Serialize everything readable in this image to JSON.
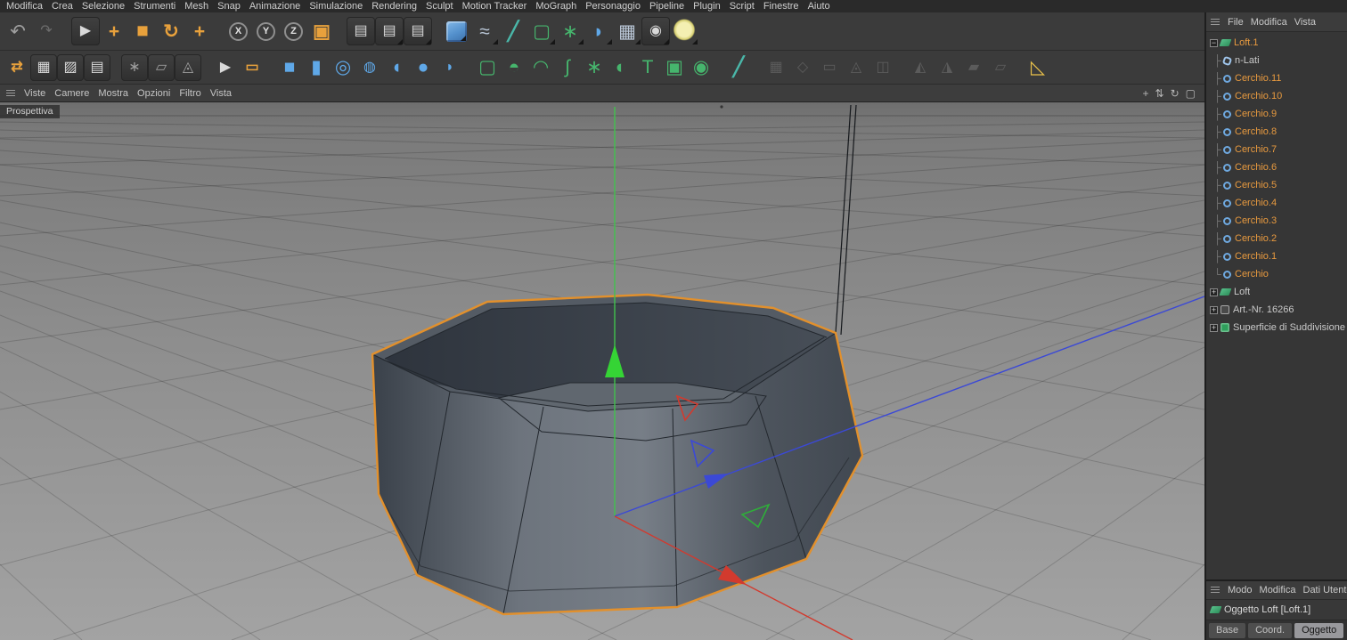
{
  "menubar": {
    "items": [
      "Modifica",
      "Crea",
      "Selezione",
      "Strumenti",
      "Mesh",
      "Snap",
      "Animazione",
      "Simulazione",
      "Rendering",
      "Sculpt",
      "Motion Tracker",
      "MoGraph",
      "Personaggio",
      "Pipeline",
      "Plugin",
      "Script",
      "Finestre",
      "Aiuto"
    ]
  },
  "toolbar": {
    "row1": [
      {
        "name": "undo",
        "glyph": "↶",
        "style": "gray xl"
      },
      {
        "name": "redo",
        "glyph": "↷",
        "style": "dim"
      },
      {
        "sep": true
      },
      {
        "name": "live-selection-tool",
        "glyph": "▶",
        "style": "btn light"
      },
      {
        "name": "move-tool",
        "glyph": "+",
        "style": "orange xl"
      },
      {
        "name": "scale-tool",
        "glyph": "◼",
        "style": "orange"
      },
      {
        "name": "rotate-tool",
        "glyph": "↻",
        "style": "orange xl"
      },
      {
        "name": "active-tool-move",
        "glyph": "+",
        "style": "orange xl"
      },
      {
        "sep": true
      },
      {
        "name": "x-axis-lock",
        "glyph": "X",
        "style": "ring"
      },
      {
        "name": "y-axis-lock",
        "glyph": "Y",
        "style": "ring"
      },
      {
        "name": "z-axis-lock",
        "glyph": "Z",
        "style": "ring"
      },
      {
        "name": "coordinate-system",
        "glyph": "▣",
        "style": "orange xl"
      },
      {
        "sep": true
      },
      {
        "name": "render-view",
        "glyph": "▤",
        "style": "btn light"
      },
      {
        "name": "render-picture-viewer",
        "glyph": "▤",
        "style": "btn light",
        "corner": true
      },
      {
        "name": "render-settings",
        "glyph": "▤",
        "style": "btn light",
        "corner": true
      },
      {
        "sep": true
      },
      {
        "name": "add-cube-primitive",
        "glyph": "",
        "style": "cube",
        "corner": true
      },
      {
        "name": "add-spline-pen",
        "glyph": "≈",
        "style": "bluegray xl",
        "corner": true
      },
      {
        "name": "sketch-pen",
        "glyph": "╱",
        "style": "teal xl"
      },
      {
        "name": "add-subdivision-surface",
        "glyph": "▢",
        "style": "green xl",
        "corner": true
      },
      {
        "name": "add-array-generator",
        "glyph": "∗",
        "style": "green xl",
        "corner": true
      },
      {
        "name": "add-deformer",
        "glyph": "◗",
        "style": "blue xl",
        "corner": true
      },
      {
        "name": "add-floor-object",
        "glyph": "▦",
        "style": "bluegray xl",
        "corner": true
      },
      {
        "name": "add-camera-object",
        "glyph": "◉",
        "style": "btn light",
        "corner": true
      },
      {
        "name": "add-light-object",
        "glyph": "",
        "style": "bulb",
        "corner": true
      }
    ],
    "row2": [
      {
        "name": "make-editable",
        "glyph": "⇄",
        "style": "orange"
      },
      {
        "name": "model-mode",
        "glyph": "▦",
        "style": "btn light"
      },
      {
        "name": "texture-mode",
        "glyph": "▨",
        "style": "btn light"
      },
      {
        "name": "workplane-mode",
        "glyph": "▤",
        "style": "btn light"
      },
      {
        "sep": true
      },
      {
        "name": "points-mode",
        "glyph": "∗",
        "style": "btn gray"
      },
      {
        "name": "edges-mode",
        "glyph": "▱",
        "style": "btn gray"
      },
      {
        "name": "polygons-mode",
        "glyph": "◬",
        "style": "btn gray"
      },
      {
        "sep": true
      },
      {
        "name": "live-selection-2",
        "glyph": "▶",
        "style": "light"
      },
      {
        "name": "rectangle-selection",
        "glyph": "▭",
        "style": "orange"
      },
      {
        "sep": true
      },
      {
        "name": "cube-primitive",
        "glyph": "■",
        "style": "blue xl"
      },
      {
        "name": "cylinder-primitive",
        "glyph": "▮",
        "style": "blue xl"
      },
      {
        "name": "tube-primitive",
        "glyph": "◎",
        "style": "blue xl"
      },
      {
        "name": "disc-primitive",
        "glyph": "◍",
        "style": "blue"
      },
      {
        "name": "torus-primitive",
        "glyph": "◖",
        "style": "blue xl"
      },
      {
        "name": "sphere-primitive",
        "glyph": "●",
        "style": "blue xl"
      },
      {
        "name": "oil-tank-primitive",
        "glyph": "◗",
        "style": "blue"
      },
      {
        "sep": true
      },
      {
        "name": "loft-generator",
        "glyph": "▢",
        "style": "green xl"
      },
      {
        "name": "lathe-generator",
        "glyph": "◓",
        "style": "green xl"
      },
      {
        "name": "sweep-generator",
        "glyph": "◠",
        "style": "green xl"
      },
      {
        "name": "bezier-generator",
        "glyph": "∫",
        "style": "green xl"
      },
      {
        "name": "atom-array",
        "glyph": "∗",
        "style": "green xl"
      },
      {
        "name": "boole-object",
        "glyph": "◐",
        "style": "green xl"
      },
      {
        "name": "text-object",
        "glyph": "T",
        "style": "green xl"
      },
      {
        "name": "instance-object",
        "glyph": "▣",
        "style": "green xl"
      },
      {
        "name": "metaball-object",
        "glyph": "◉",
        "style": "green xl"
      },
      {
        "sep": true
      },
      {
        "name": "spline-pen-2",
        "glyph": "╱",
        "style": "teal xl"
      },
      {
        "sep": true
      },
      {
        "name": "mesh-tool-1",
        "glyph": "▦",
        "style": "gray disabled"
      },
      {
        "name": "mesh-tool-2",
        "glyph": "◇",
        "style": "gray disabled"
      },
      {
        "name": "mesh-tool-3",
        "glyph": "▭",
        "style": "gray disabled"
      },
      {
        "name": "mesh-tool-4",
        "glyph": "◬",
        "style": "gray disabled"
      },
      {
        "name": "mesh-tool-5",
        "glyph": "◫",
        "style": "gray disabled"
      },
      {
        "sep": true
      },
      {
        "name": "snap-tool-1",
        "glyph": "◭",
        "style": "gray disabled"
      },
      {
        "name": "snap-tool-2",
        "glyph": "◮",
        "style": "gray disabled"
      },
      {
        "name": "snap-tool-3",
        "glyph": "▰",
        "style": "gray disabled"
      },
      {
        "name": "snap-tool-4",
        "glyph": "▱",
        "style": "gray disabled"
      },
      {
        "sep": true
      },
      {
        "name": "measure-tool",
        "glyph": "◺",
        "style": "yellow xl"
      }
    ]
  },
  "viewport": {
    "label": "Prospettiva",
    "menu": [
      "Viste",
      "Camere",
      "Mostra",
      "Opzioni",
      "Filtro",
      "Vista"
    ],
    "nav_icons": [
      {
        "name": "pan-view-icon",
        "glyph": "+"
      },
      {
        "name": "zoom-view-icon",
        "glyph": "⇅"
      },
      {
        "name": "orbit-view-icon",
        "glyph": "↻"
      },
      {
        "name": "toggle-layout-icon",
        "glyph": "▢"
      }
    ]
  },
  "object_manager": {
    "menu": [
      "File",
      "Modifica",
      "Vista"
    ],
    "rows": [
      {
        "label": "Loft.1",
        "color": "orange",
        "icon": "loft",
        "expand": "−",
        "tick": ""
      },
      {
        "label": "n-Lati",
        "color": "gray",
        "icon": "ngon",
        "tick": "├"
      },
      {
        "label": "Cerchio.11",
        "color": "orange",
        "icon": "circle",
        "tick": "├"
      },
      {
        "label": "Cerchio.10",
        "color": "orange",
        "icon": "circle",
        "tick": "├"
      },
      {
        "label": "Cerchio.9",
        "color": "orange",
        "icon": "circle",
        "tick": "├"
      },
      {
        "label": "Cerchio.8",
        "color": "orange",
        "icon": "circle",
        "tick": "├"
      },
      {
        "label": "Cerchio.7",
        "color": "orange",
        "icon": "circle",
        "tick": "├"
      },
      {
        "label": "Cerchio.6",
        "color": "orange",
        "icon": "circle",
        "tick": "├"
      },
      {
        "label": "Cerchio.5",
        "color": "orange",
        "icon": "circle",
        "tick": "├"
      },
      {
        "label": "Cerchio.4",
        "color": "orange",
        "icon": "circle",
        "tick": "├"
      },
      {
        "label": "Cerchio.3",
        "color": "orange",
        "icon": "circle",
        "tick": "├"
      },
      {
        "label": "Cerchio.2",
        "color": "orange",
        "icon": "circle",
        "tick": "├"
      },
      {
        "label": "Cerchio.1",
        "color": "orange",
        "icon": "circle",
        "tick": "├"
      },
      {
        "label": "Cerchio",
        "color": "orange",
        "icon": "circle",
        "tick": "└"
      },
      {
        "label": "Loft",
        "color": "gray",
        "icon": "loft",
        "expand": "+",
        "tick": ""
      },
      {
        "label": "Art.-Nr. 16266",
        "color": "gray",
        "icon": "null",
        "expand": "+",
        "tick": ""
      },
      {
        "label": "Superficie di Suddivisione",
        "color": "gray",
        "icon": "sds",
        "expand": "+",
        "tick": ""
      }
    ]
  },
  "attributes": {
    "menu": [
      "Modo",
      "Modifica",
      "Dati Utente"
    ],
    "title": "Oggetto Loft [Loft.1]",
    "tabs": [
      "Base",
      "Coord.",
      "Oggetto"
    ],
    "active_tab": "Oggetto"
  },
  "colors": {
    "selection_orange": "#e2902c",
    "tool_orange": "#e8a13c",
    "tree_orange": "#e89a3f",
    "axis_x_red": "#d23a2e",
    "axis_y_green": "#35d435",
    "axis_z_blue": "#3b49d6",
    "menubar_bg": "#2a2a2a",
    "toolbar_bg": "#3b3b3b",
    "panel_bg": "#363636",
    "viewport_top": "#6e6e6e",
    "viewport_bottom": "#a3a3a3"
  }
}
